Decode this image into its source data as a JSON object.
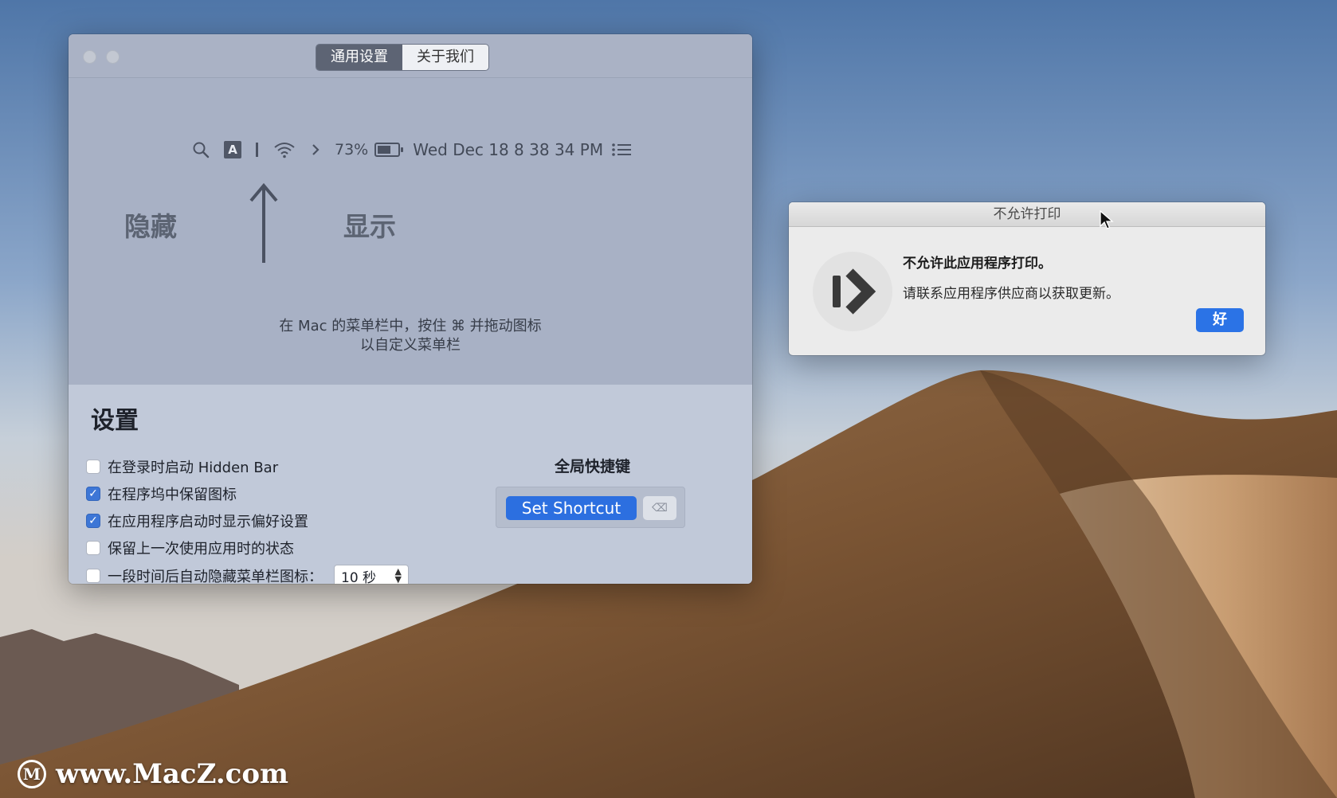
{
  "prefs_window": {
    "tabs": [
      {
        "label": "通用设置",
        "active": true
      },
      {
        "label": "关于我们",
        "active": false
      }
    ],
    "menubar": {
      "input_badge": "A",
      "battery_percent": "73%",
      "datetime": "Wed Dec 18  8 38 34 PM"
    },
    "label_hide": "隐藏",
    "label_show": "显示",
    "hint_line1": "在 Mac 的菜单栏中，按住 ⌘ 并拖动图标",
    "hint_line2": "以自定义菜单栏",
    "settings": {
      "title": "设置",
      "options": [
        {
          "label": "在登录时启动 Hidden Bar",
          "checked": false
        },
        {
          "label": "在程序坞中保留图标",
          "checked": true
        },
        {
          "label": "在应用程序启动时显示偏好设置",
          "checked": true
        },
        {
          "label": "保留上一次使用应用时的状态",
          "checked": false
        },
        {
          "label": "一段时间后自动隐藏菜单栏图标：",
          "checked": false
        }
      ],
      "autohide_value": "10 秒",
      "shortcut_title": "全局快捷键",
      "set_shortcut_label": "Set Shortcut",
      "clear_label": "⌫"
    }
  },
  "alert": {
    "title": "不允许打印",
    "message": "不允许此应用程序打印。",
    "info": "请联系应用程序供应商以获取更新。",
    "ok_label": "好"
  },
  "watermark": {
    "text": "www.MacZ.com"
  },
  "colors": {
    "accent_blue": "#2c6fe0",
    "checkbox_blue": "#3d76d6"
  }
}
